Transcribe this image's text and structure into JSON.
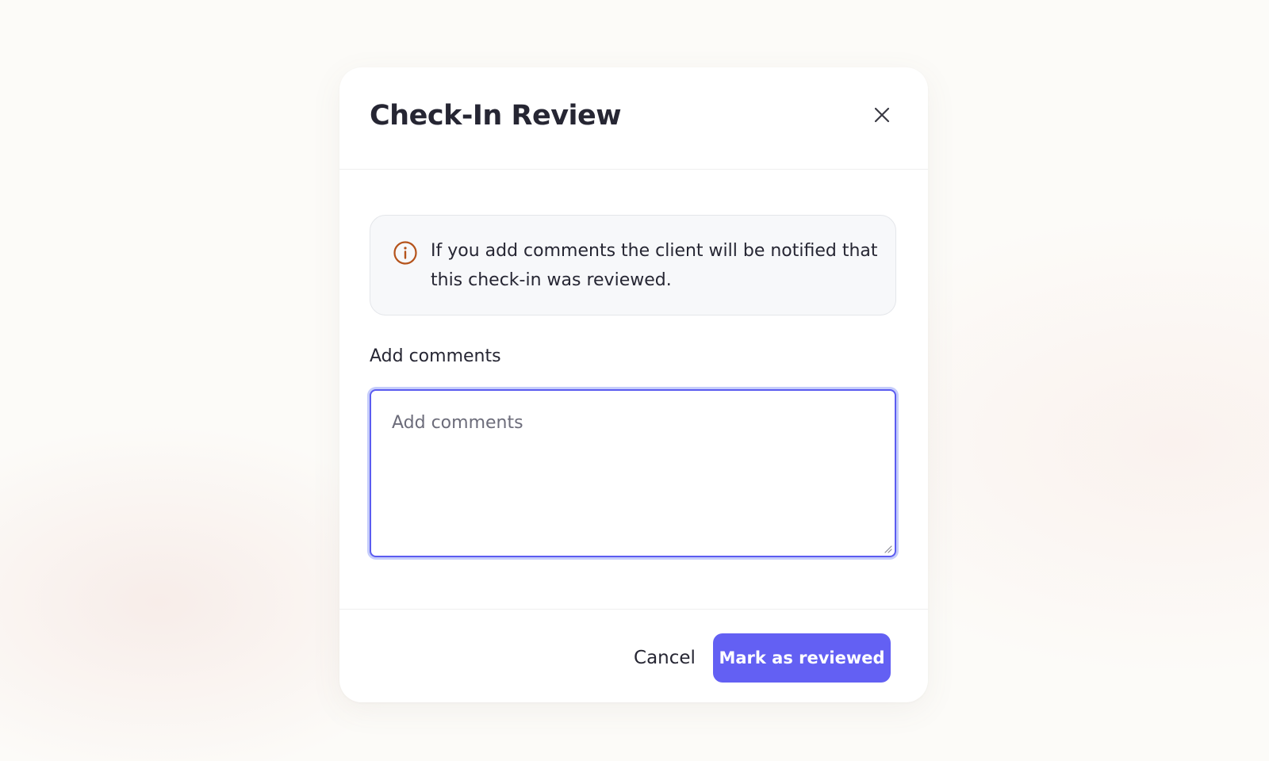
{
  "modal": {
    "title": "Check-In Review",
    "close_icon": "close-icon"
  },
  "notice": {
    "icon": "info-icon",
    "icon_color": "#b5531b",
    "text": "If you add comments the client will be notified that this check-in was reviewed."
  },
  "comments": {
    "label": "Add comments",
    "placeholder": "Add comments",
    "value": "",
    "focus_color": "#5b5cf0"
  },
  "footer": {
    "cancel_label": "Cancel",
    "submit_label": "Mark as reviewed",
    "submit_color": "#6360f3"
  }
}
